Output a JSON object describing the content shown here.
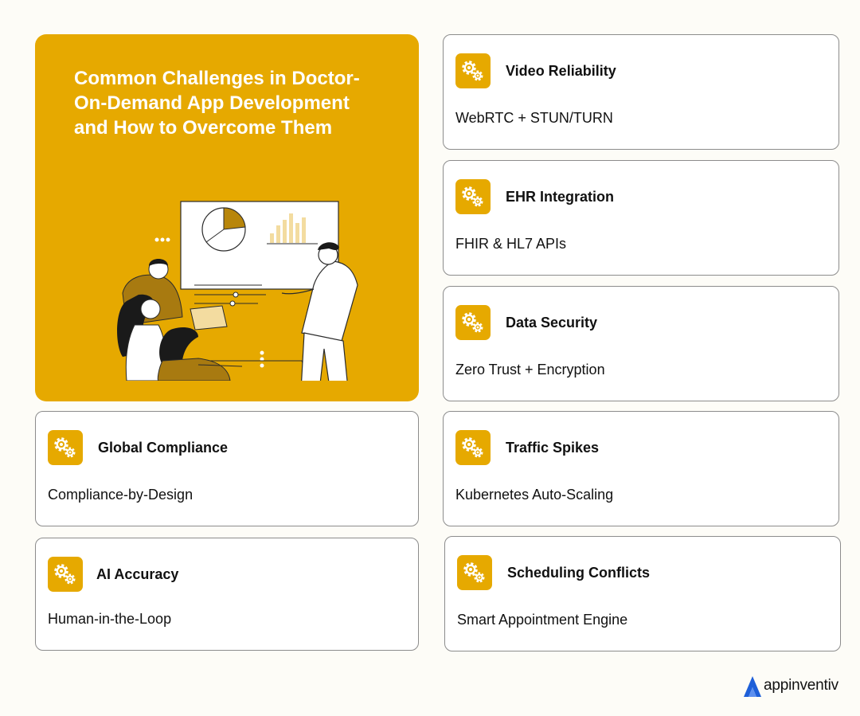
{
  "hero": {
    "title": "Common Challenges in Doctor-On-Demand App Development and How to Overcome Them",
    "accent_color": "#e6a900"
  },
  "cards": [
    {
      "id": "video-reliability",
      "title": "Video Reliability",
      "description": "WebRTC + STUN/TURN",
      "icon": "gears-icon"
    },
    {
      "id": "ehr-integration",
      "title": "EHR Integration",
      "description": "FHIR & HL7 APIs",
      "icon": "gears-icon"
    },
    {
      "id": "data-security",
      "title": "Data Security",
      "description": "Zero Trust + Encryption",
      "icon": "gears-icon"
    },
    {
      "id": "global-compliance",
      "title": "Global Compliance",
      "description": "Compliance-by-Design",
      "icon": "gears-icon"
    },
    {
      "id": "traffic-spikes",
      "title": "Traffic Spikes",
      "description": "Kubernetes Auto-Scaling",
      "icon": "gears-icon"
    },
    {
      "id": "ai-accuracy",
      "title": "AI Accuracy",
      "description": "Human-in-the-Loop",
      "icon": "gears-icon"
    },
    {
      "id": "scheduling-conflicts",
      "title": "Scheduling Conflicts",
      "description": "Smart Appointment Engine",
      "icon": "gears-icon"
    }
  ],
  "brand": {
    "name": "appinventiv",
    "color": "#1e5fd8"
  }
}
